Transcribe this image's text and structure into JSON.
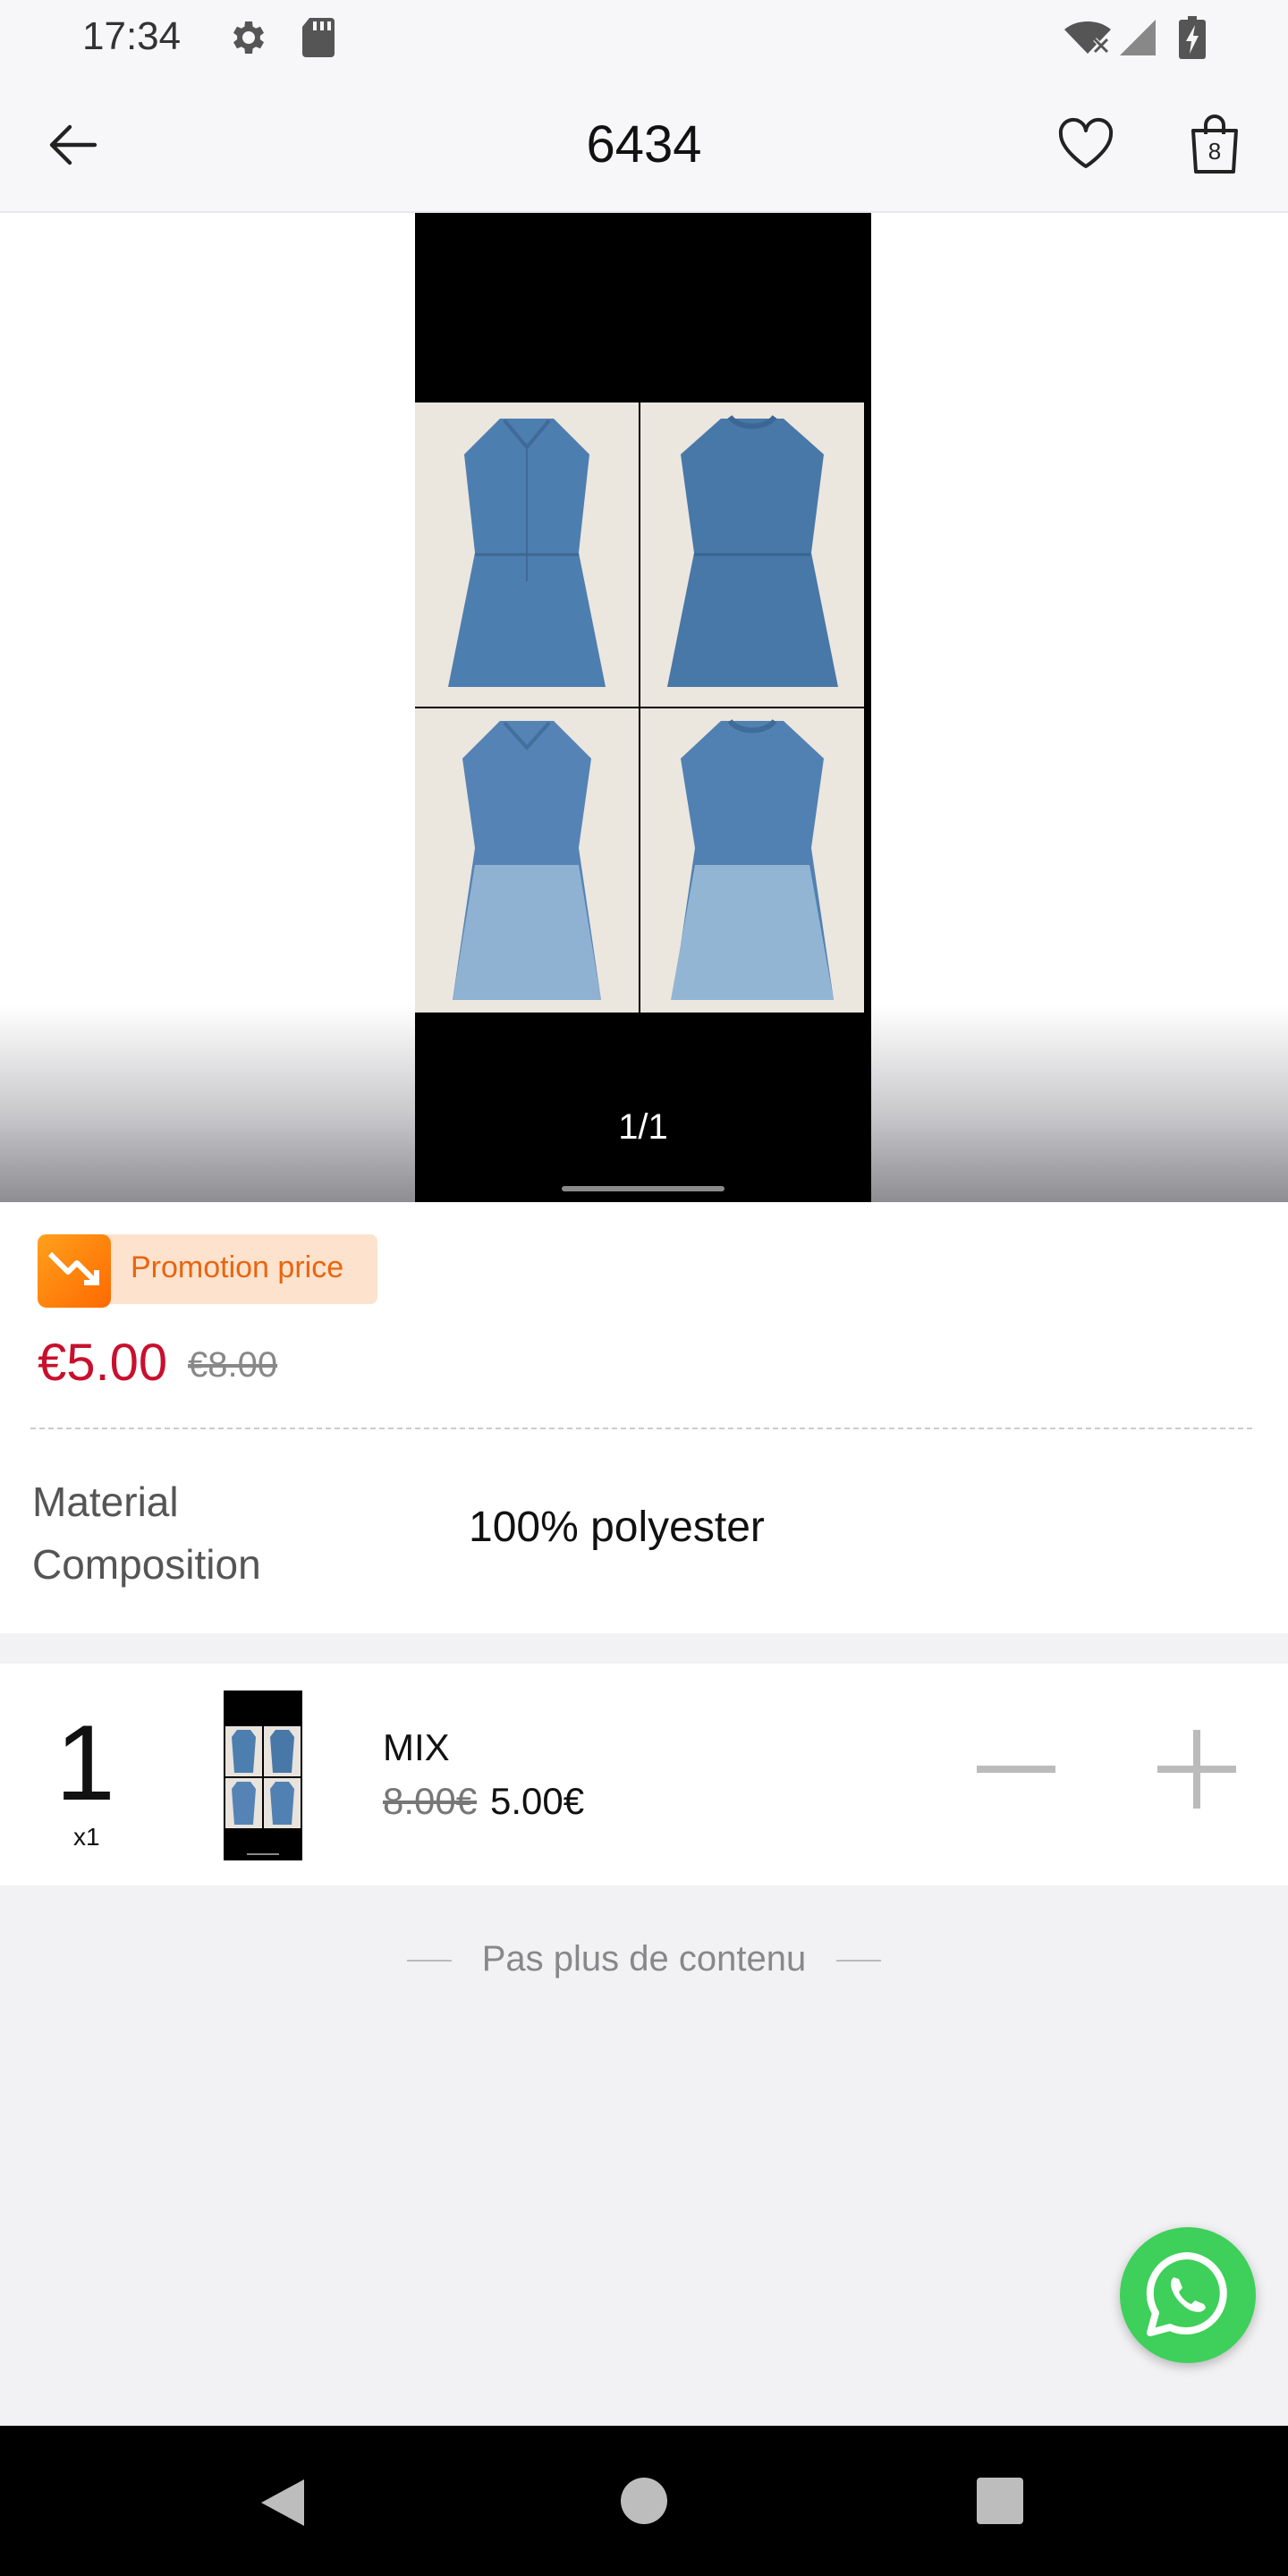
{
  "status_bar": {
    "time": "17:34",
    "icons": [
      "settings-icon",
      "sd-card-icon",
      "wifi-off-icon",
      "cell-signal-icon",
      "battery-charging-icon"
    ]
  },
  "header": {
    "title": "6434",
    "cart_count": "8",
    "icons": [
      "back-arrow-icon",
      "heart-icon",
      "shopping-bag-icon"
    ]
  },
  "gallery": {
    "page_indicator": "1/1"
  },
  "price": {
    "promo_label": "Promotion price",
    "current": "€5.00",
    "original": "€8.00",
    "accent_color": "#c8102e",
    "promo_color": "#e9650e"
  },
  "attributes": [
    {
      "label": "Material Composition",
      "value": "100% polyester"
    }
  ],
  "variant": {
    "quantity": "1",
    "quantity_multiplier": "x1",
    "name": "MIX",
    "old_price": "8.00€",
    "new_price": "5.00€"
  },
  "footer": {
    "no_more_text": "Pas plus de contenu"
  },
  "floating": {
    "icon": "whatsapp-icon",
    "color": "#3ed05a"
  },
  "nav": {
    "icons": [
      "back-triangle-icon",
      "home-circle-icon",
      "recents-square-icon"
    ]
  }
}
